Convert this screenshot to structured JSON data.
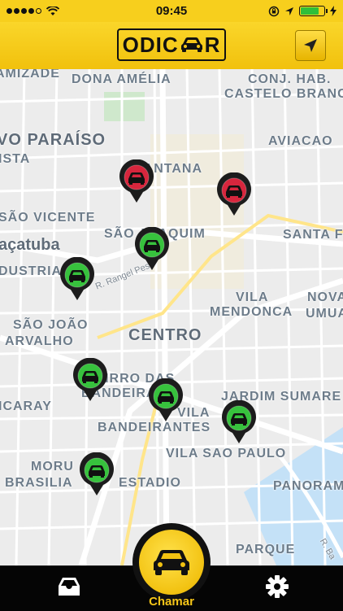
{
  "status_bar": {
    "time": "09:45",
    "signal_dots_filled": 4,
    "signal_dots_total": 5,
    "battery_percent": 80,
    "icons": [
      "signal-dots-icon",
      "wifi-icon",
      "rotation-lock-icon",
      "location-arrow-icon",
      "battery-icon",
      "charging-bolt-icon"
    ]
  },
  "header": {
    "logo_left": "ODIC",
    "logo_right": "R",
    "logo_car_icon": "car-icon",
    "locate_icon": "navigation-arrow-icon"
  },
  "map": {
    "labels": [
      {
        "id": "amizade",
        "text": "AMIZADE",
        "style": "normal"
      },
      {
        "id": "dona-amelia",
        "text": "DONA AMÉLIA",
        "style": "normal"
      },
      {
        "id": "conj-hab",
        "text": "CONJ. HAB.",
        "style": "normal"
      },
      {
        "id": "castelo-branco",
        "text": "CASTELO BRANCO",
        "style": "normal"
      },
      {
        "id": "novo-paraiso",
        "text": "VO PARAÍSO",
        "style": "big"
      },
      {
        "id": "aviacao",
        "text": "AVIACAO",
        "style": "normal"
      },
      {
        "id": "ista",
        "text": "ISTA",
        "style": "normal"
      },
      {
        "id": "santana",
        "text": "SANTANA",
        "style": "normal"
      },
      {
        "id": "sao-vicente",
        "text": "SÃO VICENTE",
        "style": "normal"
      },
      {
        "id": "sao-joaquim",
        "text": "SÃO JOAQUIM",
        "style": "normal"
      },
      {
        "id": "santa",
        "text": "SANTA F",
        "style": "normal"
      },
      {
        "id": "acatuba",
        "text": "açatuba",
        "style": "city"
      },
      {
        "id": "dustria",
        "text": "DUSTRIA",
        "style": "normal"
      },
      {
        "id": "rangel",
        "text": "R. Rangel Pes",
        "style": "street"
      },
      {
        "id": "vila",
        "text": "VILA",
        "style": "normal"
      },
      {
        "id": "mendonca",
        "text": "MENDONCA",
        "style": "normal"
      },
      {
        "id": "nova",
        "text": "NOVA",
        "style": "normal"
      },
      {
        "id": "umua",
        "text": "UMUA",
        "style": "normal"
      },
      {
        "id": "sao-joao",
        "text": "SÃO JOÃO",
        "style": "normal"
      },
      {
        "id": "arvalho",
        "text": "ARVALHO",
        "style": "normal"
      },
      {
        "id": "centro",
        "text": "CENTRO",
        "style": "big"
      },
      {
        "id": "bairro-das",
        "text": "BAIRRO DAS",
        "style": "normal"
      },
      {
        "id": "bandeirantes-1",
        "text": "BANDEIRAS",
        "style": "normal"
      },
      {
        "id": "icaray",
        "text": "ICARAY",
        "style": "normal"
      },
      {
        "id": "vila-2",
        "text": "VILA",
        "style": "normal"
      },
      {
        "id": "bandeirantes-2",
        "text": "BANDEIRANTES",
        "style": "normal"
      },
      {
        "id": "jardim-sumare",
        "text": "JARDIM SUMARE",
        "style": "normal"
      },
      {
        "id": "vila-sao-paulo",
        "text": "VILA SAO PAULO",
        "style": "normal"
      },
      {
        "id": "morumbi",
        "text": "MORU",
        "style": "normal"
      },
      {
        "id": "brasilia",
        "text": "BRASILIA",
        "style": "normal"
      },
      {
        "id": "estadio",
        "text": "ESTADIO",
        "style": "normal"
      },
      {
        "id": "panoram",
        "text": "PANORAM",
        "style": "normal"
      },
      {
        "id": "parque",
        "text": "PARQUE",
        "style": "normal"
      },
      {
        "id": "r-ba",
        "text": "R. Ba",
        "style": "street"
      }
    ],
    "drivers": [
      {
        "id": "driver-1",
        "status": "busy",
        "color": "#d7263d"
      },
      {
        "id": "driver-2",
        "status": "busy",
        "color": "#d7263d"
      },
      {
        "id": "driver-3",
        "status": "available",
        "color": "#37c23d"
      },
      {
        "id": "driver-4",
        "status": "available",
        "color": "#37c23d"
      },
      {
        "id": "driver-5",
        "status": "available",
        "color": "#37c23d"
      },
      {
        "id": "driver-6",
        "status": "available",
        "color": "#37c23d"
      },
      {
        "id": "driver-7",
        "status": "available",
        "color": "#37c23d"
      },
      {
        "id": "driver-8",
        "status": "available",
        "color": "#37c23d"
      }
    ]
  },
  "bottom_bar": {
    "inbox_icon": "inbox-tray-icon",
    "call_label": "Chamar",
    "call_icon": "car-icon",
    "settings_icon": "gear-icon"
  },
  "colors": {
    "brand_yellow": "#f5c518",
    "busy_red": "#d7263d",
    "available_green": "#37c23d"
  }
}
